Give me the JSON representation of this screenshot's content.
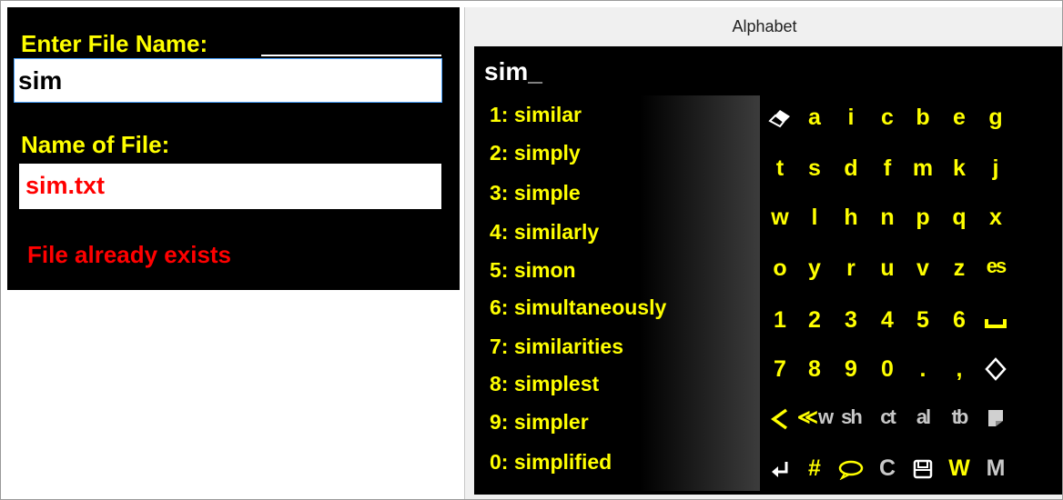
{
  "left_panel": {
    "enter_file_name_label": "Enter File Name:",
    "entry_value": "sim",
    "name_of_file_label": "Name of File:",
    "file_name_value": "sim.txt",
    "error_message": "File already exists"
  },
  "keyboard": {
    "window_title": "Alphabet",
    "typed_text": "sim_",
    "predictions": [
      "1: similar",
      "2: simply",
      "3: simple",
      "4: similarly",
      "5: simon",
      "6: simultaneously",
      "7: similarities",
      "8: simplest",
      "9: simpler",
      "0: simplified"
    ],
    "letter_rows": [
      [
        "a",
        "i",
        "c",
        "b",
        "e",
        "g"
      ],
      [
        "t",
        "s",
        "d",
        "f",
        "m",
        "k",
        "j"
      ],
      [
        "w",
        "l",
        "h",
        "n",
        "p",
        "q",
        "x"
      ],
      [
        "o",
        "y",
        "r",
        "u",
        "v",
        "z"
      ],
      [
        "1",
        "2",
        "3",
        "4",
        "5",
        "6"
      ],
      [
        "7",
        "8",
        "9",
        "0",
        ".",
        ","
      ]
    ],
    "es_key": "es",
    "space_key": "␣",
    "combo_keys": [
      "w",
      "sh",
      "ct",
      "al",
      "tb"
    ],
    "bottom_keys": {
      "hash": "#",
      "c": "C",
      "w": "W",
      "m": "M"
    },
    "icons": {
      "eraser": "eraser-icon",
      "diamond": "diamond-icon",
      "back": "back-arrow-icon",
      "back_word": "back-word-icon",
      "note": "note-icon",
      "enter": "enter-icon",
      "speech": "speech-bubble-icon",
      "save": "save-icon"
    },
    "colors": {
      "key_text": "#ffff00",
      "background": "#000000",
      "error": "#ff0000"
    }
  }
}
